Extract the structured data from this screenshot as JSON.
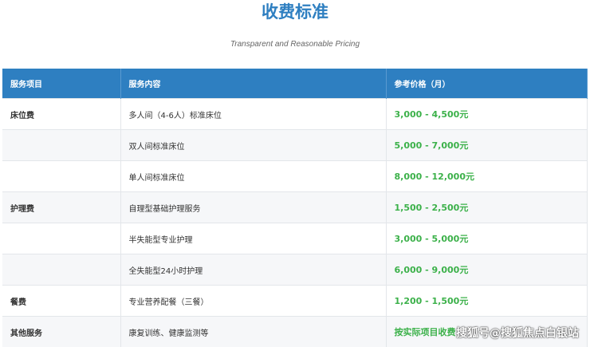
{
  "title": "收费标准",
  "subtitle": "Transparent and Reasonable Pricing",
  "headers": [
    "服务项目",
    "服务内容",
    "参考价格（月）"
  ],
  "rows": [
    {
      "category": "床位费",
      "content": "多人间（4-6人）标准床位",
      "price": "3,000 - 4,500元"
    },
    {
      "category": "",
      "content": "双人间标准床位",
      "price": "5,000 - 7,000元"
    },
    {
      "category": "",
      "content": "单人间标准床位",
      "price": "8,000 - 12,000元"
    },
    {
      "category": "护理费",
      "content": "自理型基础护理服务",
      "price": "1,500 - 2,500元"
    },
    {
      "category": "",
      "content": "半失能型专业护理",
      "price": "3,000 - 5,000元"
    },
    {
      "category": "",
      "content": "全失能型24小时护理",
      "price": "6,000 - 9,000元"
    },
    {
      "category": "餐费",
      "content": "专业营养配餐（三餐）",
      "price": "1,200 - 1,500元"
    },
    {
      "category": "其他服务",
      "content": "康复训练、健康监测等",
      "price": "按实际项目收费"
    }
  ],
  "watermark": "搜狐号@搜狐焦点白银站",
  "colors": {
    "accent": "#2e7fc1",
    "price": "#3cb14a"
  }
}
